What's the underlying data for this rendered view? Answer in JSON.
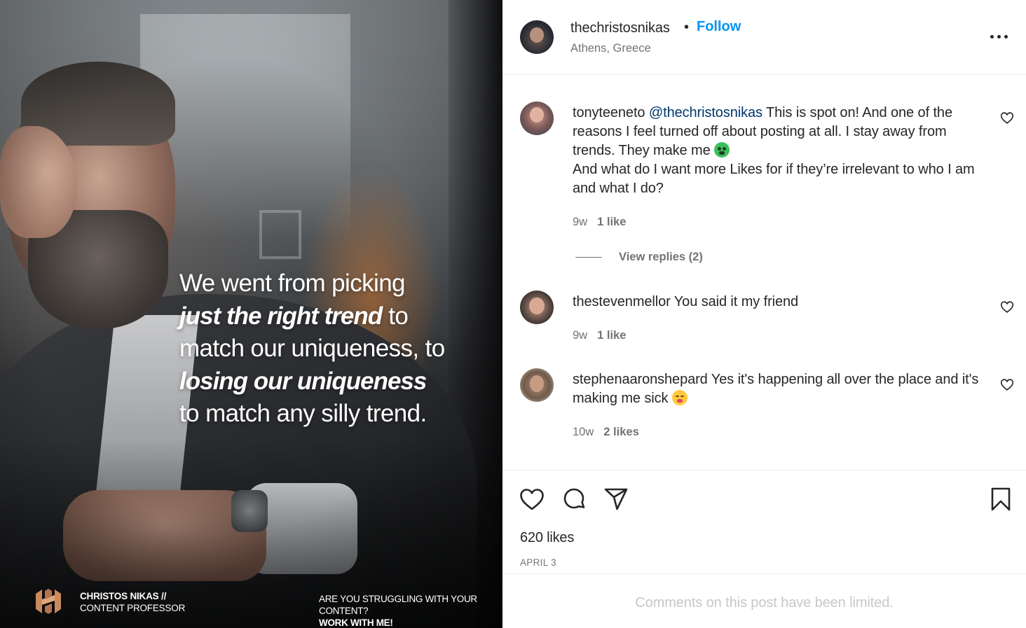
{
  "post_image": {
    "quote_lines": [
      {
        "text": "We went from picking",
        "strong": false
      },
      {
        "text": "just the right trend",
        "strong": true,
        "suffix": " to"
      },
      {
        "text": "match our uniqueness, to",
        "strong": false
      },
      {
        "text": "losing our uniqueness",
        "strong": true
      },
      {
        "text": "to match any silly trend.",
        "strong": false
      }
    ],
    "brand_name": "CHRISTOS NIKAS //",
    "brand_subtitle": "CONTENT PROFESSOR",
    "cta_line1": "ARE YOU STRUGGLING WITH YOUR",
    "cta_line2_prefix": "CONTENT? ",
    "cta_line2_bold": "WORK WITH ME!",
    "logo_color": "#c98a5e"
  },
  "header": {
    "username": "thechristosnikas",
    "separator": "•",
    "follow_label": "Follow",
    "location": "Athens, Greece",
    "more_icon": "more-horizontal-icon"
  },
  "comments": [
    {
      "username": "tonyteeneto",
      "mention": "@thechristosnikas",
      "text_part1": " This is spot on! And one of the reasons I feel turned off about posting at all. I stay away from trends. They make me ",
      "emoji": "nauseated-face",
      "text_part2": "And what do I want more Likes for if they’re irrelevant to who I am and what I do?",
      "time": "9w",
      "likes": "1 like",
      "view_replies": "View replies (2)"
    },
    {
      "username": "thestevenmellor",
      "text": " You said it my friend",
      "time": "9w",
      "likes": "1 like"
    },
    {
      "username": "stephenaaronshepard",
      "text": " Yes it's happening all over the place and it's making me sick ",
      "emoji": "tired-face",
      "time": "10w",
      "likes": "2 likes"
    }
  ],
  "actions": {
    "like_icon": "heart-icon",
    "comment_icon": "comment-icon",
    "share_icon": "send-icon",
    "save_icon": "bookmark-icon",
    "likes_count": "620 likes",
    "date": "APRIL 3"
  },
  "comments_limited": "Comments on this post have been limited.",
  "colors": {
    "follow": "#0095f6",
    "mention": "#00376b",
    "secondary_text": "#737373",
    "muted_text": "#c7c7c7"
  }
}
